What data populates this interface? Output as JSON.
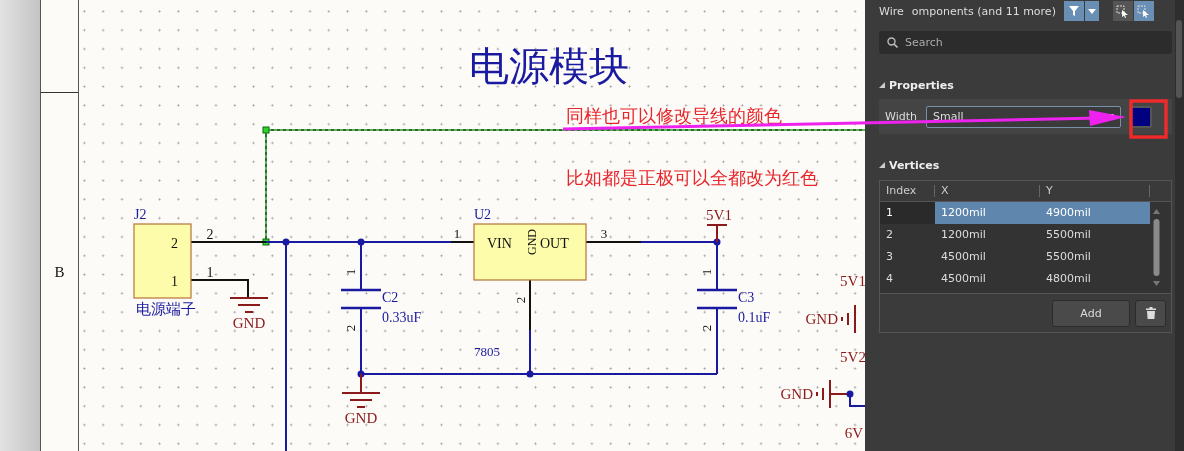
{
  "frame": {
    "zone": "B"
  },
  "schematic": {
    "title": "电源模块",
    "wire_selected": true,
    "connector": {
      "ref": "J2",
      "name": "电源端子",
      "pins": [
        "2",
        "1"
      ],
      "pin_numbers": [
        "2",
        "1"
      ]
    },
    "regulator": {
      "ref": "U2",
      "value": "7805",
      "in": "VIN",
      "gnd": "GND",
      "out": "OUT",
      "pins": [
        "1",
        "2",
        "3"
      ]
    },
    "capacitors": [
      {
        "ref": "C2",
        "value": "0.33uF",
        "pins": [
          "1",
          "2"
        ]
      },
      {
        "ref": "C3",
        "value": "0.1uF",
        "pins": [
          "1",
          "2"
        ]
      }
    ],
    "power_ports": [
      {
        "kind": "bar",
        "label": "5V1"
      },
      {
        "kind": "ground",
        "label": "GND"
      },
      {
        "kind": "ground",
        "label": "GND"
      },
      {
        "kind": "net",
        "label": "5V1"
      },
      {
        "kind": "ground_side",
        "label": "GND"
      },
      {
        "kind": "net",
        "label": "5V2"
      },
      {
        "kind": "ground_side",
        "label": "GND"
      },
      {
        "kind": "net",
        "label": "6V"
      }
    ]
  },
  "annotations": [
    {
      "kind": "note",
      "text": "同样也可以修改导线的颜色"
    },
    {
      "kind": "note",
      "text": "比如都是正极可以全都改为红色"
    }
  ],
  "panel": {
    "object_kind": "Wire",
    "filter_text": "omponents (and 11 more)",
    "filter_on": true,
    "select_modes": [
      {
        "selected": false
      },
      {
        "selected": true
      }
    ],
    "search": {
      "placeholder": "Search"
    },
    "properties": {
      "title": "Properties",
      "expanded": true,
      "width_label": "Width",
      "width_value": "Small",
      "color": "#000080"
    },
    "vertices": {
      "title": "Vertices",
      "expanded": true,
      "columns": [
        "Index",
        "X",
        "Y"
      ],
      "rows": [
        {
          "cells": [
            "1",
            "1200mil",
            "4900mil"
          ],
          "selected": true
        },
        {
          "cells": [
            "2",
            "1200mil",
            "5500mil"
          ],
          "selected": false
        },
        {
          "cells": [
            "3",
            "4500mil",
            "5500mil"
          ],
          "selected": false
        },
        {
          "cells": [
            "4",
            "4500mil",
            "4800mil"
          ],
          "selected": false
        }
      ],
      "add_label": "Add"
    }
  }
}
